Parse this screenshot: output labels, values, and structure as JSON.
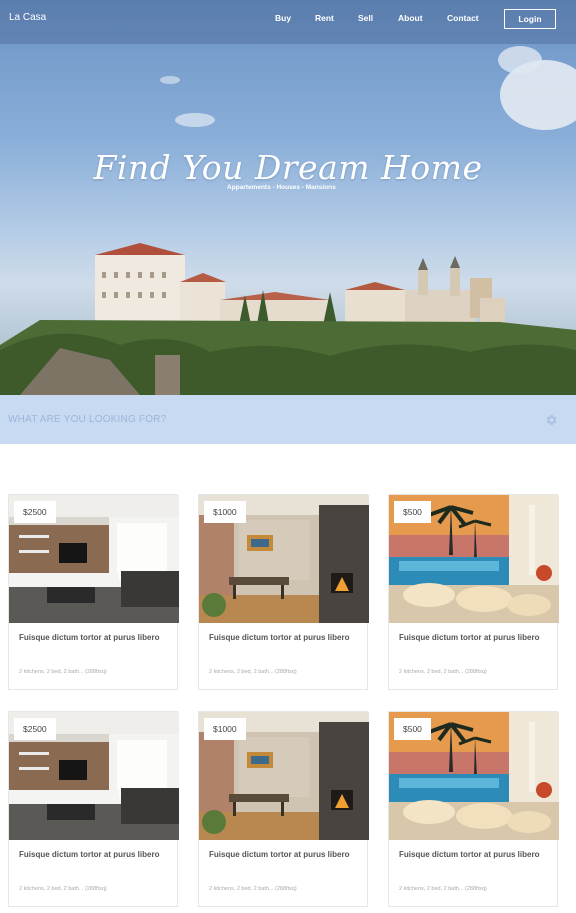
{
  "nav": {
    "brand": "La Casa",
    "links": [
      "Buy",
      "Rent",
      "Sell",
      "About",
      "Contact"
    ],
    "login": "Login"
  },
  "hero": {
    "headline": "Find You Dream Home",
    "subline": "Appartements - Houses - Mansions"
  },
  "search": {
    "placeholder": "WHAT ARE YOU LOOKING FOR?",
    "icon": "gear-icon"
  },
  "listings": [
    {
      "price": "$2500",
      "title": "Fuisque dictum tortor at purus libero",
      "meta": "2 kitchens, 2 bed, 2 bath... (288ftsq)",
      "photo": "living-room"
    },
    {
      "price": "$1000",
      "title": "Fuisque dictum tortor at purus libero",
      "meta": "2 kitchens, 2 bed, 2 bath... (288ftsq)",
      "photo": "dining-room"
    },
    {
      "price": "$500",
      "title": "Fuisque dictum tortor at purus libero",
      "meta": "2 kitchens, 2 bed, 2 bath... (288ftsq)",
      "photo": "pool-terrace"
    },
    {
      "price": "$2500",
      "title": "Fuisque dictum tortor at purus libero",
      "meta": "2 kitchens, 2 bed, 2 bath... (288ftsq)",
      "photo": "living-room"
    },
    {
      "price": "$1000",
      "title": "Fuisque dictum tortor at purus libero",
      "meta": "2 kitchens, 2 bed, 2 bath... (288ftsq)",
      "photo": "dining-room"
    },
    {
      "price": "$500",
      "title": "Fuisque dictum tortor at purus libero",
      "meta": "2 kitchens, 2 bed, 2 bath... (288ftsq)",
      "photo": "pool-terrace"
    }
  ],
  "colors": {
    "search_bar": "#c8daf2",
    "search_text": "#9bb6d9",
    "card_border": "#e6e6e6"
  }
}
